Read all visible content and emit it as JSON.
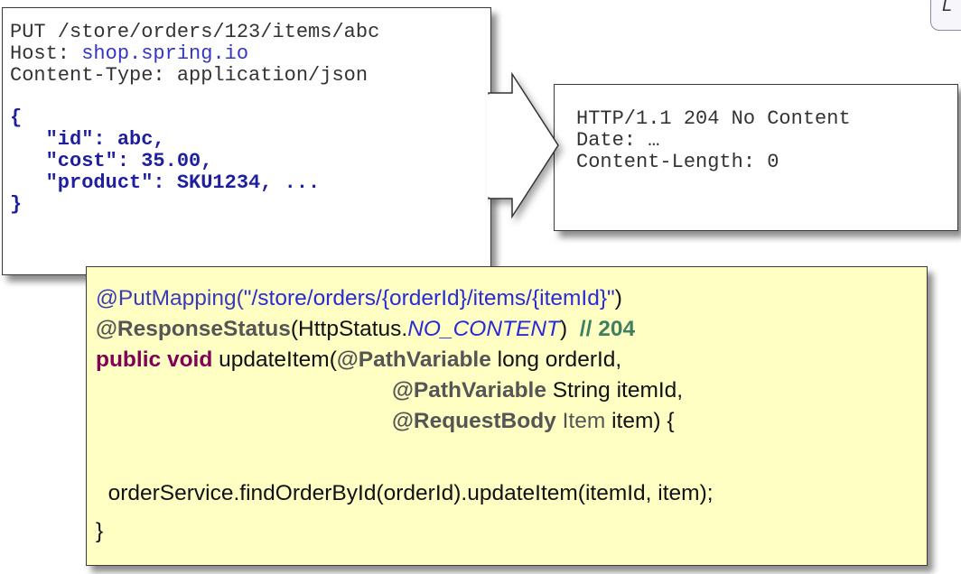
{
  "request": {
    "line1": "PUT /store/orders/123/items/abc",
    "host_key": "Host: ",
    "host_value": "shop.spring.io",
    "content_type": "Content-Type: application/json",
    "open_brace": "{",
    "body_line1": "   \"id\": abc,",
    "body_line2": "   \"cost\": 35.00,",
    "body_line3": "   \"product\": SKU1234, ...",
    "close_brace": "}"
  },
  "response": {
    "status": "HTTP/1.1 204 No Content",
    "date": "Date: …",
    "content_length": "Content-Length: 0"
  },
  "code": {
    "l1_ann": "@PutMapping(",
    "l1_str": "\"/store/orders/{orderId}/items/{itemId}\"",
    "l1_end": ")",
    "l2_ann": "@ResponseStatus",
    "l2_mid": "(HttpStatus.",
    "l2_it": "NO_CONTENT",
    "l2_end": ")  ",
    "l2_cmt": "// 204",
    "l3_kw": "public void",
    "l3_rest": " updateItem(",
    "l3_ann": "@PathVariable",
    "l3_end": " long orderId,",
    "l4_ann": "@PathVariable",
    "l4_end": " String itemId,",
    "l5_ann": "@RequestBody",
    "l5_mid": " Item",
    "l5_end": " item) {",
    "l7": "  orderService.findOrderById(orderId).updateItem(itemId, item);",
    "l8": "}"
  },
  "colors": {
    "code_background": "#ffffc4",
    "keyword": "#7f0055",
    "comment": "#3f7f5f",
    "annotation": "#3b3bb8",
    "json_bold": "#1f1f9e"
  },
  "tab": {
    "letter": "L"
  },
  "footer": {
    "tiny": ""
  }
}
